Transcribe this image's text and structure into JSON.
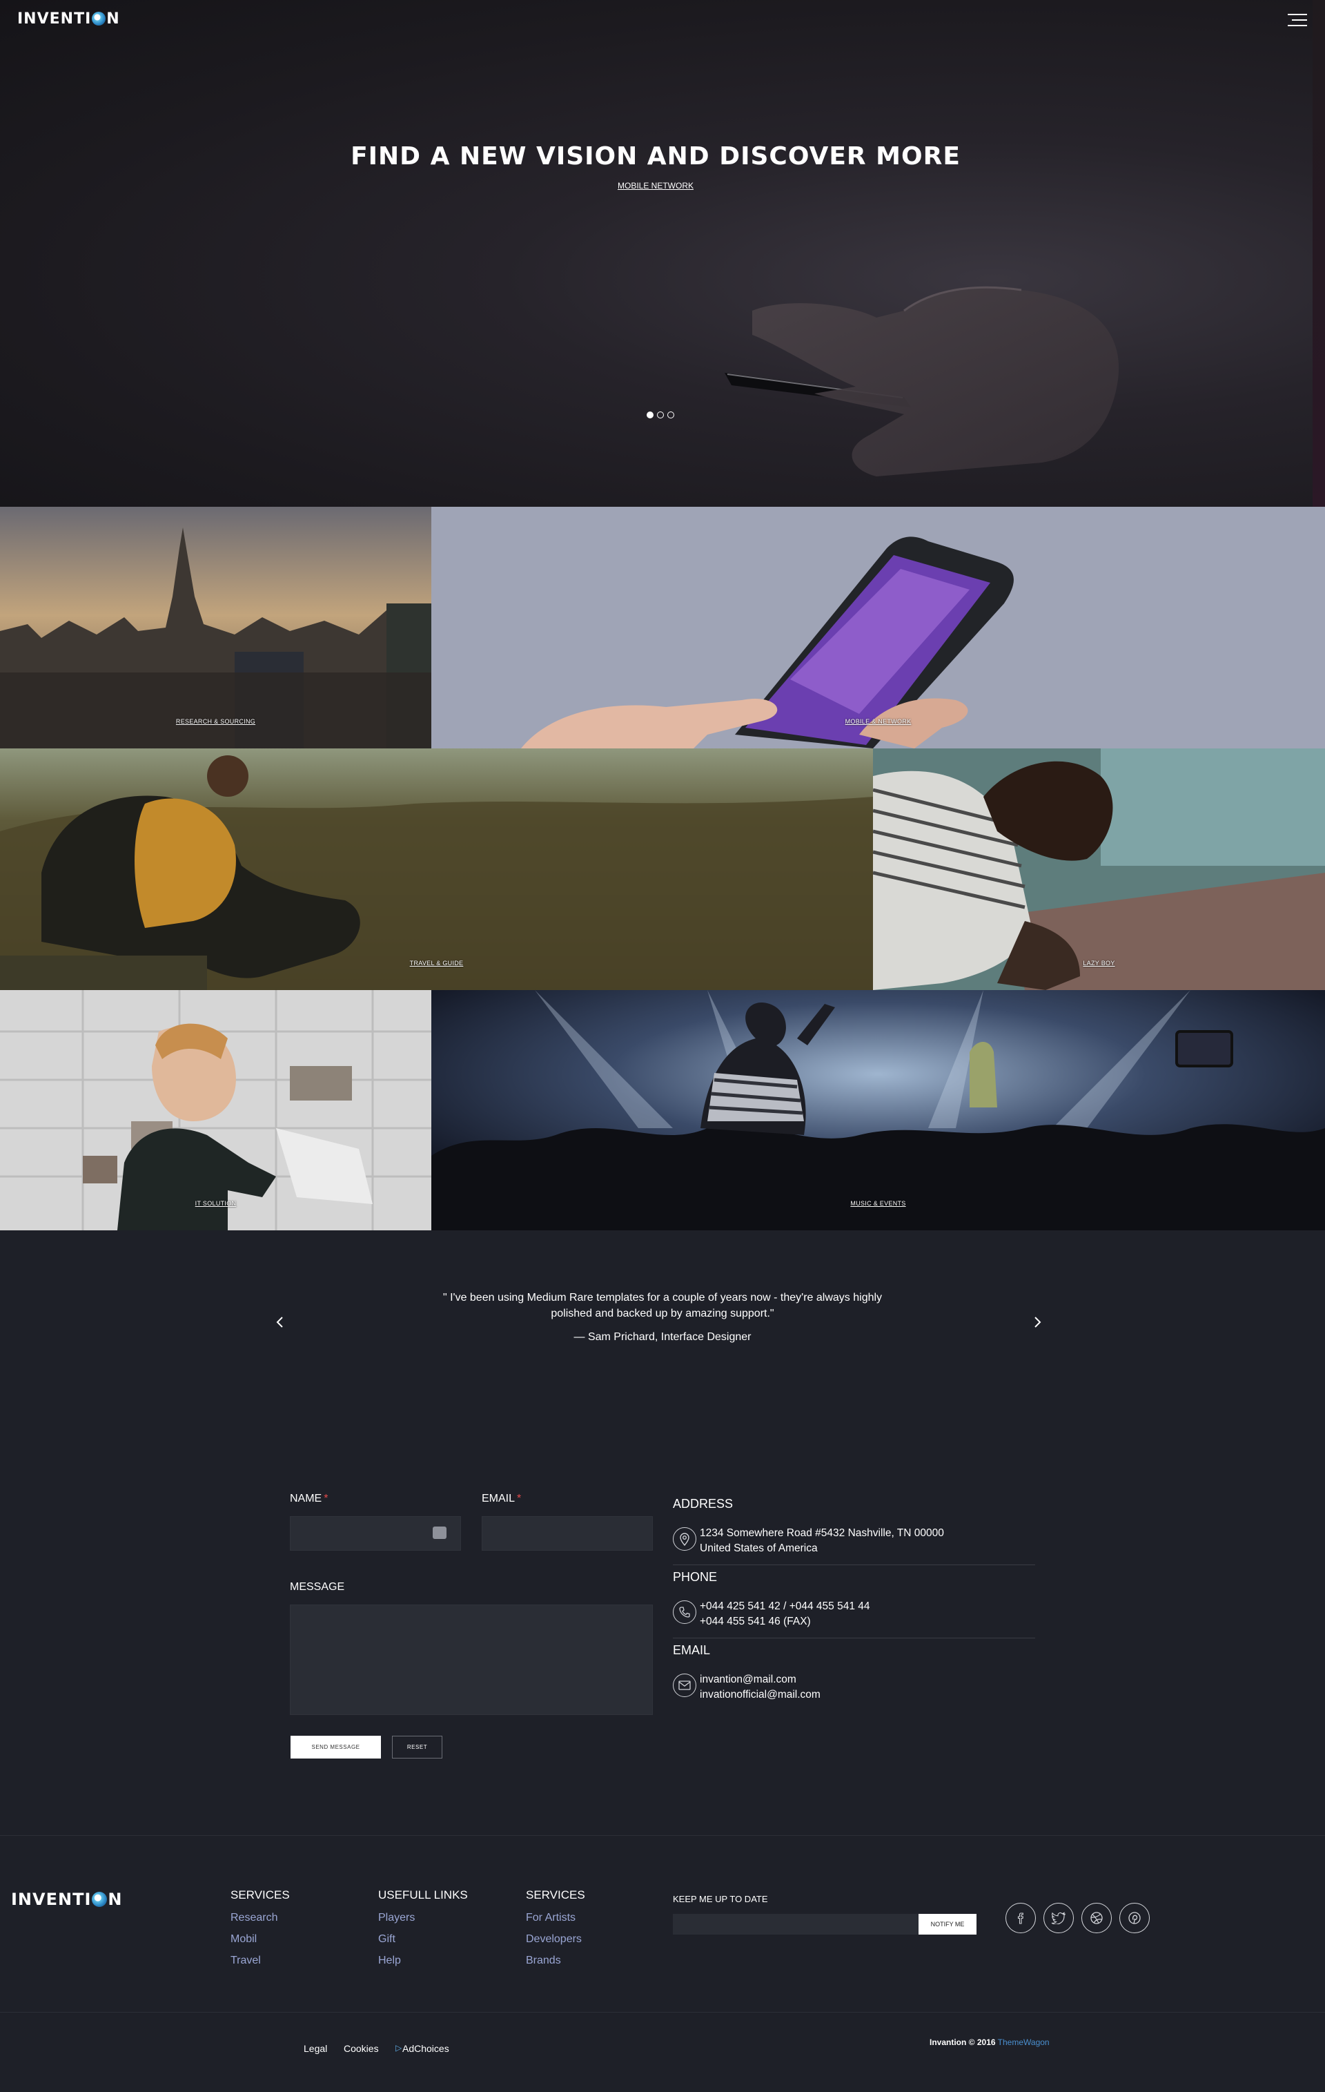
{
  "header": {
    "logo_text_a": "INVENTI",
    "logo_text_b": "N",
    "menu_icon": "hamburger-menu-icon"
  },
  "hero": {
    "title": "FIND A NEW VISION AND DISCOVER MORE",
    "subtitle": "MOBILE NETWORK",
    "slides_total": 3,
    "slide_active": 1
  },
  "portfolio": {
    "items": [
      {
        "label": "RESEARCH & SOURCING"
      },
      {
        "label": "MOBILE & NETWORK"
      },
      {
        "label": "TRAVEL & GUIDE"
      },
      {
        "label": "LAZY BOY"
      },
      {
        "label": "IT SOLUTION"
      },
      {
        "label": "MUSIC & EVENTS"
      }
    ]
  },
  "testimonial": {
    "quote": "\" I've been using Medium Rare templates for a couple of years now - they're always highly polished and backed up by amazing support.\"",
    "author": "— Sam Prichard, Interface Designer",
    "prev_icon": "chevron-left-icon",
    "next_icon": "chevron-right-icon"
  },
  "contact_form": {
    "name_label": "NAME",
    "email_label": "EMAIL",
    "required_mark": "*",
    "message_label": "MESSAGE",
    "send_label": "SEND MESSAGE",
    "reset_label": "RESET"
  },
  "contact_info": {
    "address_heading": "ADDRESS",
    "address_line1": "1234 Somewhere Road #5432 Nashville, TN 00000",
    "address_line2": "United States of America",
    "phone_heading": "PHONE",
    "phone_line1": "+044 425 541 42 / +044 455 541 44",
    "phone_line2": "+044 455 541 46 (FAX)",
    "email_heading": "EMAIL",
    "email_line1": "invantion@mail.com",
    "email_line2": "invationofficial@mail.com"
  },
  "footer": {
    "col1": {
      "title": "SERVICES",
      "links": [
        "Research",
        "Mobil",
        "Travel"
      ]
    },
    "col2": {
      "title": "USEFULL LINKS",
      "links": [
        "Players",
        "Gift",
        "Help"
      ]
    },
    "col3": {
      "title": "SERVICES",
      "links": [
        "For Artists",
        "Developers",
        "Brands"
      ]
    },
    "newsletter_label": "KEEP ME UP TO DATE",
    "notify_label": "NOTIFY ME",
    "social_icons": [
      "facebook-icon",
      "twitter-icon",
      "dribbble-icon",
      "pinterest-icon"
    ],
    "legal": [
      "Legal",
      "Cookies",
      "AdChoices"
    ],
    "copyright": "Invantion © 2016",
    "credit": "ThemeWagon"
  },
  "colors": {
    "background": "#1e2028",
    "link": "#9aa6d4",
    "credit": "#4a8fcf",
    "required": "#e24a4a"
  }
}
